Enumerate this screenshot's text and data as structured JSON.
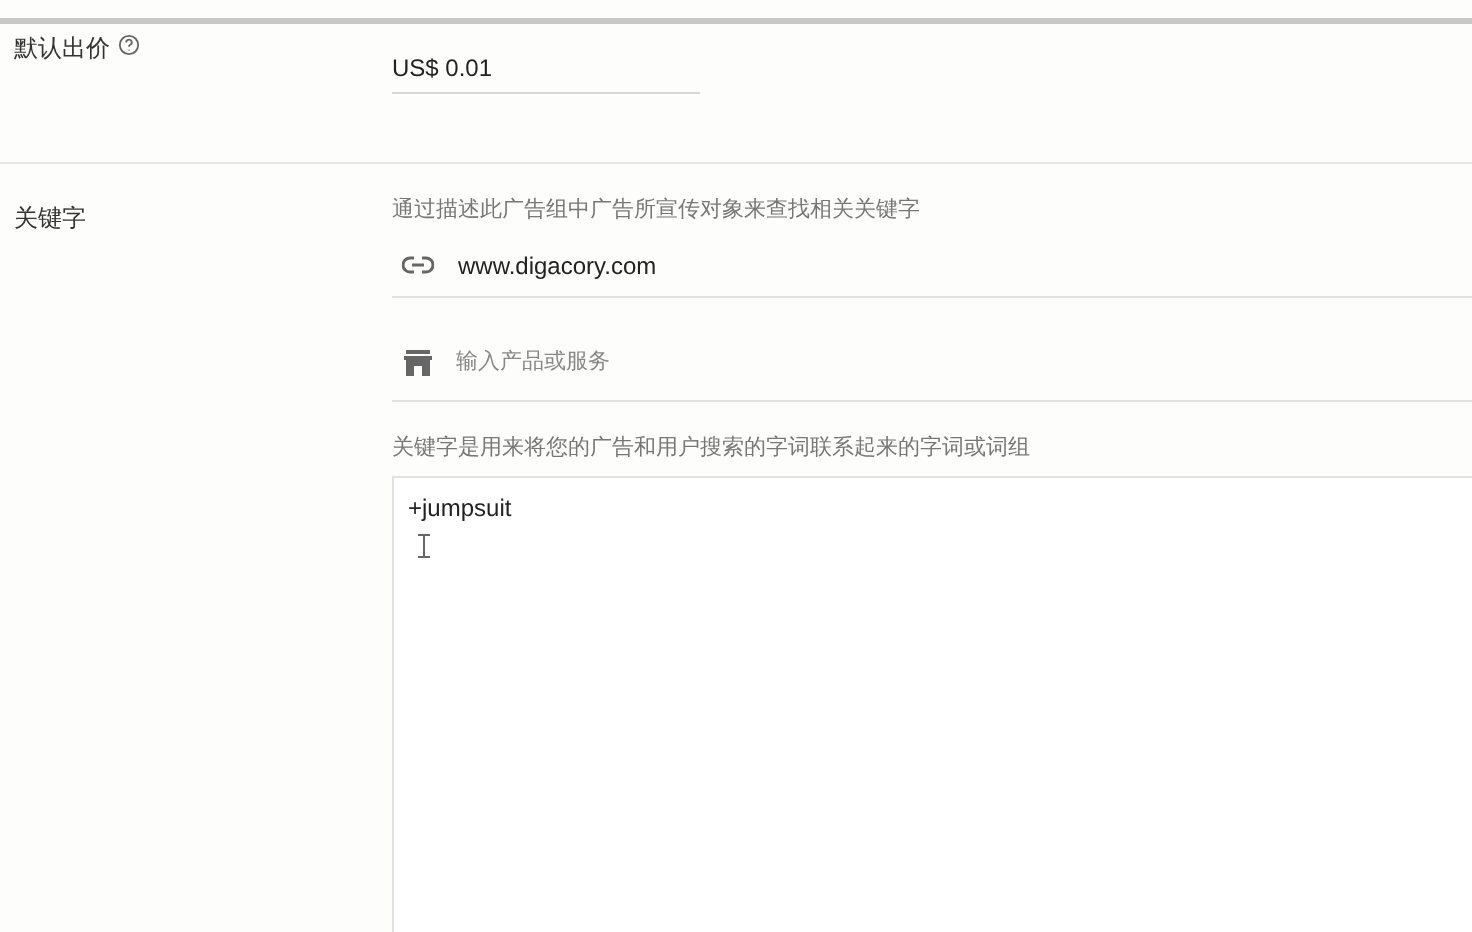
{
  "bid": {
    "label": "默认出价",
    "value": "US$ 0.01"
  },
  "keywords": {
    "label": "关键字",
    "hint": "通过描述此广告组中广告所宣传对象来查找相关关键字",
    "url": "www.digacory.com",
    "product_placeholder": "输入产品或服务",
    "help": "关键字是用来将您的广告和用户搜索的字词联系起来的字词或词组",
    "entry": "+jumpsuit"
  }
}
